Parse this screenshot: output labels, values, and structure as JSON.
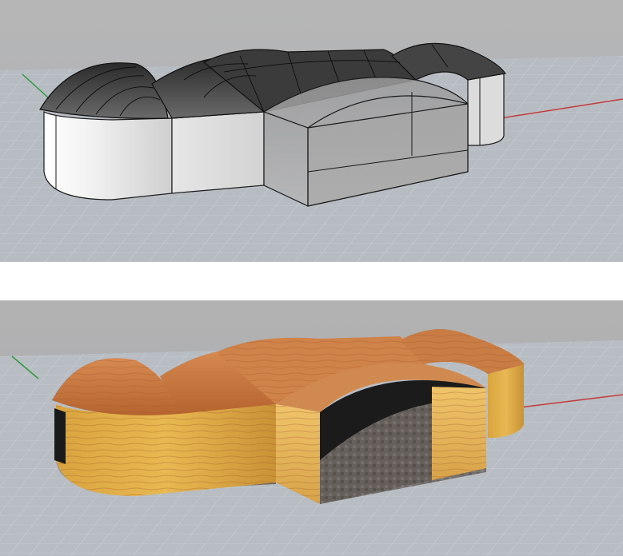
{
  "window": {
    "title": ""
  },
  "viewports": [
    {
      "id": "top",
      "display_mode": "ghosted",
      "colors": {
        "sky_top": "#b4b4b4",
        "sky_bottom": "#a9acb3",
        "grid_line": "#bcc3cb",
        "grid_major": "#9aa1aa",
        "axis_x": "#c23b3b",
        "axis_y": "#2f9a3b"
      }
    },
    {
      "id": "bottom",
      "display_mode": "rendered",
      "colors": {
        "sky_top": "#b0b0b0",
        "sky_bottom": "#a7a9ae",
        "grid_line": "#bcc3cb",
        "grid_major": "#9aa1aa",
        "axis_x": "#c23b3b",
        "axis_y": "#2f9a3b",
        "wood_light": "#e9b04a",
        "wood_dark": "#b3622e",
        "floor": "#6b6460"
      }
    }
  ],
  "model": {
    "icon": "3d-building-model-icon"
  }
}
